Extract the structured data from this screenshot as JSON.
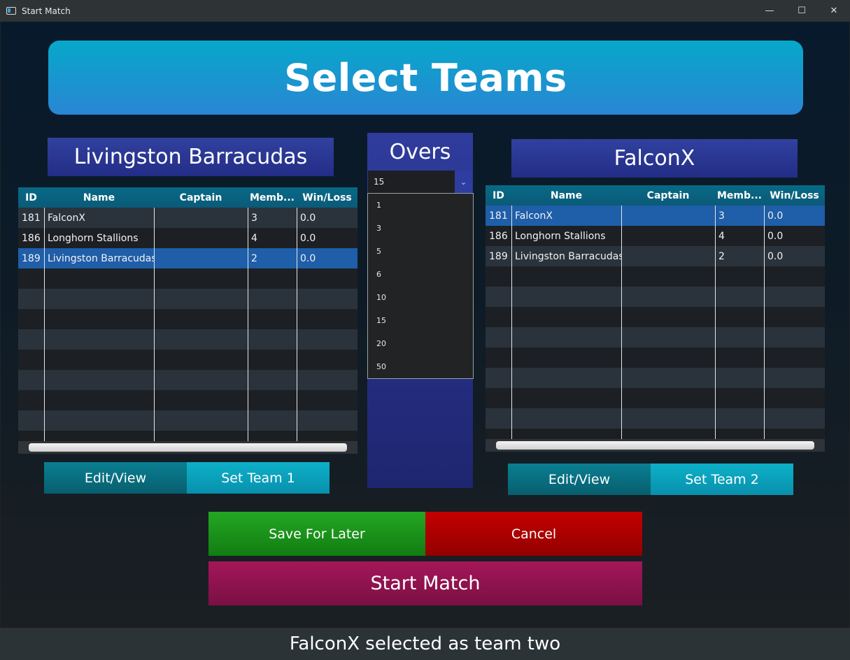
{
  "window": {
    "title": "Start Match",
    "controls": {
      "minimize": "—",
      "maximize": "☐",
      "close": "✕"
    }
  },
  "banner": {
    "title": "Select Teams"
  },
  "team1": {
    "title": "Livingston Barracudas"
  },
  "team2": {
    "title": "FalconX"
  },
  "overs": {
    "label": "Overs",
    "selected": "15",
    "options": [
      "1",
      "3",
      "5",
      "6",
      "10",
      "15",
      "20",
      "50"
    ]
  },
  "table_columns": [
    "ID",
    "Name",
    "Captain",
    "Memb...",
    "Win/Loss"
  ],
  "table1": {
    "rows": [
      {
        "id": "181",
        "name": "FalconX",
        "captain": "",
        "members": "3",
        "winloss": "0.0"
      },
      {
        "id": "186",
        "name": "Longhorn Stallions",
        "captain": "",
        "members": "4",
        "winloss": "0.0"
      },
      {
        "id": "189",
        "name": "Livingston Barracudas",
        "captain": "",
        "members": "2",
        "winloss": "0.0"
      }
    ],
    "selected_index": 2
  },
  "table2": {
    "rows": [
      {
        "id": "181",
        "name": "FalconX",
        "captain": "",
        "members": "3",
        "winloss": "0.0"
      },
      {
        "id": "186",
        "name": "Longhorn Stallions",
        "captain": "",
        "members": "4",
        "winloss": "0.0"
      },
      {
        "id": "189",
        "name": "Livingston Barracudas",
        "captain": "",
        "members": "2",
        "winloss": "0.0"
      }
    ],
    "selected_index": 0
  },
  "buttons": {
    "edit_view": "Edit/View",
    "set_team_1": "Set Team 1",
    "set_team_2": "Set Team 2",
    "save_for_later": "Save For Later",
    "cancel": "Cancel",
    "start_match": "Start Match"
  },
  "status": {
    "message": "FalconX selected as team two"
  },
  "colors": {
    "banner": "#0fa3cf",
    "team_title": "#2a3592",
    "selected_row": "#1f5ea8",
    "save": "#1c951c",
    "cancel": "#b50000",
    "start": "#92134f"
  }
}
